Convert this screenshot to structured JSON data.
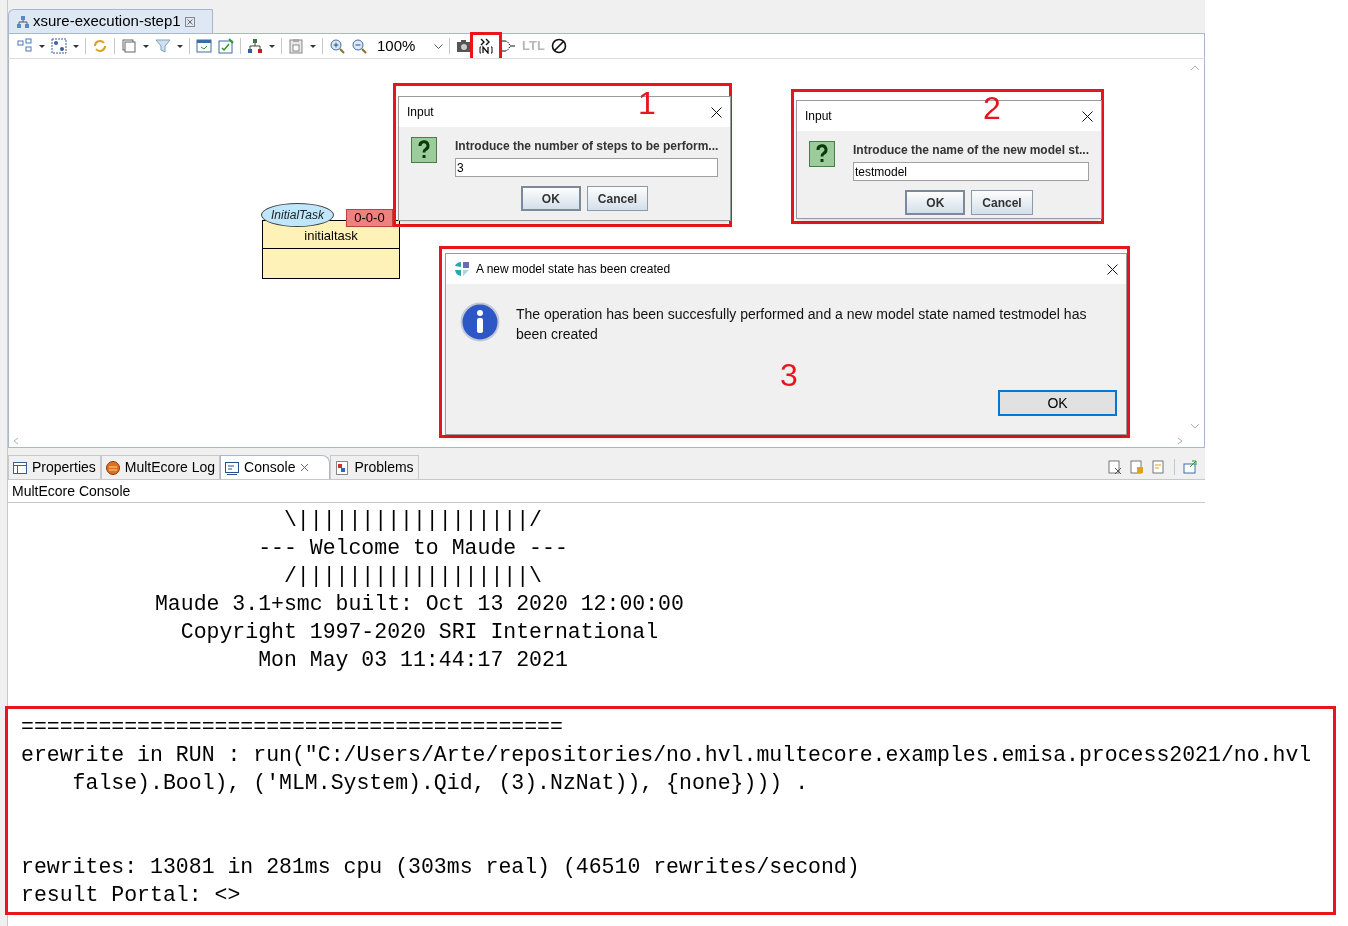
{
  "editor_tab": {
    "title": "xsure-execution-step1"
  },
  "toolbar": {
    "zoom": "100%",
    "ltl": {
      "label": "LTL",
      "disabled": true
    }
  },
  "diagram": {
    "node": {
      "type_label": "InitialTask",
      "name": "initialtask",
      "potency": "0-0-0"
    }
  },
  "dialogs": [
    {
      "kind": "input",
      "title": "Input",
      "message": "Introduce the number of steps to be perform...",
      "value": "3",
      "buttons": [
        "OK",
        "Cancel"
      ],
      "annotation": "1"
    },
    {
      "kind": "input",
      "title": "Input",
      "message": "Introduce the name of the new model st...",
      "value": "testmodel",
      "buttons": [
        "OK",
        "Cancel"
      ],
      "annotation": "2"
    },
    {
      "kind": "message",
      "title": "A new model state has been created",
      "message": "The operation has been succesfully performed and a new model state named testmodel has been created",
      "buttons": [
        "OK"
      ],
      "annotation": "3"
    }
  ],
  "bottom_tabs": [
    {
      "label": "Properties",
      "selected": false
    },
    {
      "label": "MultEcore Log",
      "selected": false
    },
    {
      "label": "Console",
      "selected": true
    },
    {
      "label": "Problems",
      "selected": false
    }
  ],
  "console": {
    "title": "MultEcore Console",
    "banner": [
      "                     \\||||||||||||||||||/",
      "                   --- Welcome to Maude ---",
      "                     /||||||||||||||||||\\",
      "           Maude 3.1+smc built: Oct 13 2020 12:00:00",
      "             Copyright 1997-2020 SRI International",
      "                   Mon May 03 11:44:17 2021"
    ],
    "command": [
      "==========================================",
      "erewrite in RUN : run(\"C:/Users/Arte/repositories/no.hvl.multecore.examples.emisa.process2021/no.hvl",
      "    false).Bool), ('MLM.System).Qid, (3).NzNat)), {none}))) ."
    ],
    "result": [
      "rewrites: 13081 in 281ms cpu (303ms real) (46510 rewrites/second)",
      "result Portal: <>"
    ]
  }
}
